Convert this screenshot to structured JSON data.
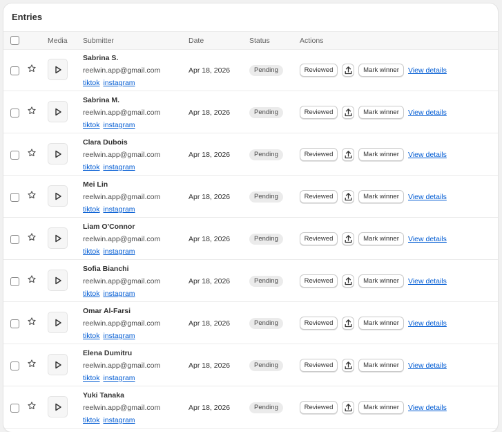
{
  "card": {
    "title": "Entries"
  },
  "columns": {
    "media": "Media",
    "submitter": "Submitter",
    "date": "Date",
    "status": "Status",
    "actions": "Actions"
  },
  "actions": {
    "reviewed_label": "Reviewed",
    "mark_winner_label": "Mark winner",
    "view_details_label": "View details",
    "upload_icon": "upload-icon",
    "star_icon": "star-icon",
    "play_icon": "play-icon"
  },
  "colors": {
    "link": "#005bd3",
    "badge_bg": "#ebebeb",
    "page_bg": "#f1f1f1"
  },
  "entries": [
    {
      "name": "Sabrina S.",
      "email": "reelwin.app@gmail.com",
      "links": [
        "tiktok",
        "instagram"
      ],
      "date": "Apr 18, 2026",
      "status": "Pending"
    },
    {
      "name": "Sabrina M.",
      "email": "reelwin.app@gmail.com",
      "links": [
        "tiktok",
        "instagram"
      ],
      "date": "Apr 18, 2026",
      "status": "Pending"
    },
    {
      "name": "Clara Dubois",
      "email": "reelwin.app@gmail.com",
      "links": [
        "tiktok",
        "instagram"
      ],
      "date": "Apr 18, 2026",
      "status": "Pending"
    },
    {
      "name": "Mei Lin",
      "email": "reelwin.app@gmail.com",
      "links": [
        "tiktok",
        "instagram"
      ],
      "date": "Apr 18, 2026",
      "status": "Pending"
    },
    {
      "name": "Liam O'Connor",
      "email": "reelwin.app@gmail.com",
      "links": [
        "tiktok",
        "instagram"
      ],
      "date": "Apr 18, 2026",
      "status": "Pending"
    },
    {
      "name": "Sofia Bianchi",
      "email": "reelwin.app@gmail.com",
      "links": [
        "tiktok",
        "instagram"
      ],
      "date": "Apr 18, 2026",
      "status": "Pending"
    },
    {
      "name": "Omar Al-Farsi",
      "email": "reelwin.app@gmail.com",
      "links": [
        "tiktok",
        "instagram"
      ],
      "date": "Apr 18, 2026",
      "status": "Pending"
    },
    {
      "name": "Elena Dumitru",
      "email": "reelwin.app@gmail.com",
      "links": [
        "tiktok",
        "instagram"
      ],
      "date": "Apr 18, 2026",
      "status": "Pending"
    },
    {
      "name": "Yuki Tanaka",
      "email": "reelwin.app@gmail.com",
      "links": [
        "tiktok",
        "instagram"
      ],
      "date": "Apr 18, 2026",
      "status": "Pending"
    }
  ]
}
